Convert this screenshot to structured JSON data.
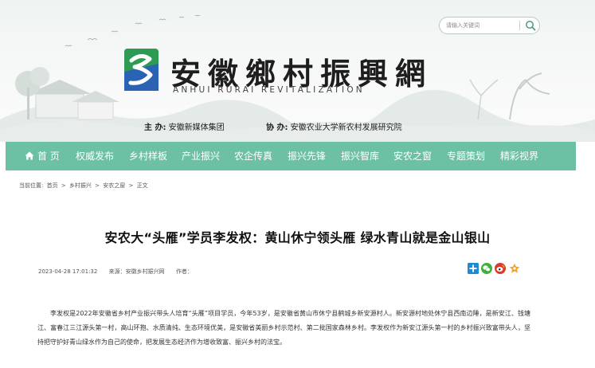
{
  "header": {
    "logo_title": "安徽鄉村振興網",
    "logo_subtitle": "ANHUI RURAI REVITALIZATION",
    "sponsor_label": "主  办:",
    "sponsor_value": "安徽新媒体集团",
    "co_sponsor_label": "协  办:",
    "co_sponsor_value": "安徽农业大学新农村发展研究院"
  },
  "search": {
    "placeholder": "请输入关键词"
  },
  "nav": {
    "items": [
      {
        "label": "首 页",
        "icon": "home-icon"
      },
      {
        "label": "权威发布"
      },
      {
        "label": "乡村样板"
      },
      {
        "label": "产业振兴"
      },
      {
        "label": "农企传真"
      },
      {
        "label": "振兴先锋"
      },
      {
        "label": "振兴智库"
      },
      {
        "label": "安农之窗"
      },
      {
        "label": "专题策划"
      },
      {
        "label": "精彩视界"
      }
    ]
  },
  "breadcrumb": {
    "prefix": "当前位置:",
    "items": [
      "首页",
      "乡村振兴",
      "安农之窗",
      "正文"
    ],
    "separator": ">"
  },
  "article": {
    "title": "安农大“头雁”学员李发权：黄山休宁领头雁 绿水青山就是金山银山",
    "datetime": "2023-04-28 17:01:32",
    "source": "来源：安徽乡村振兴网",
    "author": "作者：",
    "body": "李发权是2022年安徽省乡村产业振兴带头人培育“头雁”项目学员，今年53岁，是安徽省黄山市休宁县鹤城乡新安源村人。新安源村地处休宁县西南边陲，是新安江、钱塘江、富春江三江源头第一村，高山环抱、水质清纯、生态环境优美，是安徽省美丽乡村示范村、第二批国家森林乡村。李发权作为新安江源头第一村的乡村振兴致富带头人，坚持把守护好青山绿水作为自己的使命，把发展生态经济作为增收致富、振兴乡村的法宝。"
  },
  "share": {
    "buttons": [
      "plus-share-icon",
      "wechat-icon",
      "weibo-icon",
      "favorite-star-icon"
    ]
  },
  "colors": {
    "nav_bg": "#6cc1a5",
    "logo_green": "#2e9b55",
    "logo_blue": "#2a63b4",
    "share_blue": "#1d8ad6",
    "wechat_green": "#3fb03a",
    "weibo_red": "#e0362b",
    "star_orange": "#f0a322"
  }
}
